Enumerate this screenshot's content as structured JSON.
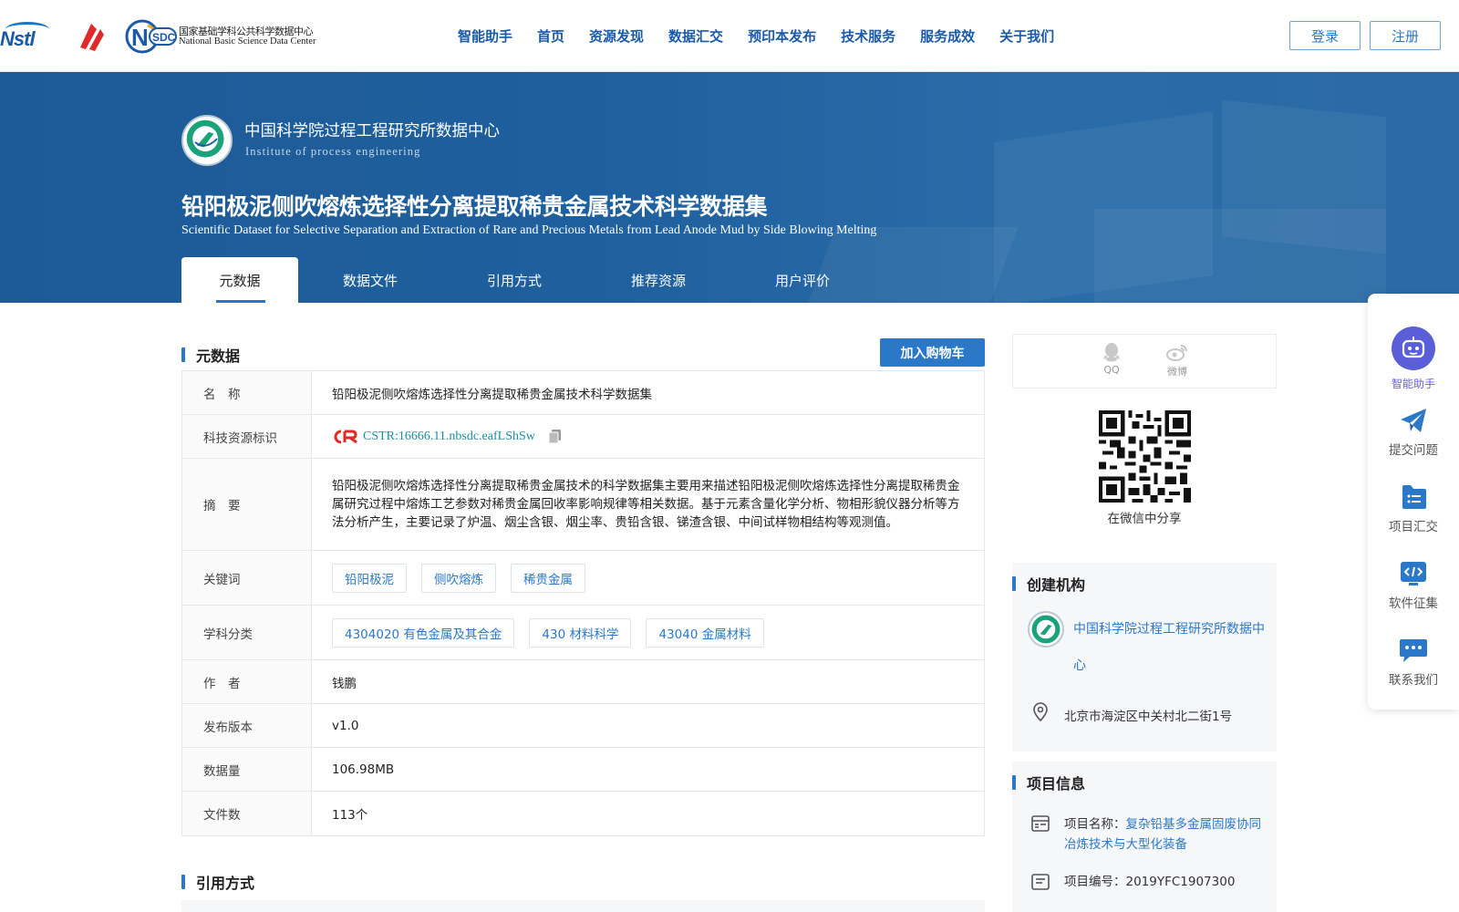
{
  "header": {
    "nav": [
      "智能助手",
      "首页",
      "资源发现",
      "数据汇交",
      "预印本发布",
      "技术服务",
      "服务成效",
      "关于我们"
    ],
    "login": "登录",
    "register": "注册",
    "nsdc_cn": "国家基础学科公共科学数据中心",
    "nsdc_en": "National Basic Science Data Center",
    "nstl_text": "Nstl",
    "nsdc_mark": "SDC"
  },
  "banner": {
    "institution_cn": "中国科学院过程工程研究所数据中心",
    "institution_en": "Institute of process engineering",
    "title": "铅阳极泥侧吹熔炼选择性分离提取稀贵金属技术科学数据集",
    "subtitle": "Scientific Dataset for Selective Separation and Extraction of Rare and Precious Metals from Lead Anode Mud by Side Blowing Melting",
    "tabs": [
      "元数据",
      "数据文件",
      "引用方式",
      "推荐资源",
      "用户评价"
    ]
  },
  "metadata": {
    "section_title": "元数据",
    "cart_button": "加入购物车",
    "rows": {
      "name_key": "名　称",
      "name_val": "铅阳极泥侧吹熔炼选择性分离提取稀贵金属技术科学数据集",
      "id_key": "科技资源标识",
      "id_val": "CSTR:16666.11.nbsdc.eafLShSw",
      "abstract_key": "摘　要",
      "abstract_val": "铅阳极泥侧吹熔炼选择性分离提取稀贵金属技术的科学数据集主要用来描述铅阳极泥侧吹熔炼选择性分离提取稀贵金属研究过程中熔炼工艺参数对稀贵金属回收率影响规律等相关数据。基于元素含量化学分析、物相形貌仪器分析等方法分析产生，主要记录了炉温、烟尘含银、烟尘率、贵铅含银、锑渣含银、中间试样物相结构等观测值。",
      "keywords_key": "关键词",
      "keywords": [
        "铅阳极泥",
        "侧吹熔炼",
        "稀贵金属"
      ],
      "subject_key": "学科分类",
      "subjects": [
        "4304020 有色金属及其合金",
        "430 材料科学",
        "43040 金属材料"
      ],
      "author_key": "作　者",
      "author_val": "钱鹏",
      "version_key": "发布版本",
      "version_val": "v1.0",
      "size_key": "数据量",
      "size_val": "106.98MB",
      "files_key": "文件数",
      "files_val": "113个"
    },
    "citation_title": "引用方式"
  },
  "share": {
    "qq": "QQ",
    "weibo": "微博",
    "wechat": "在微信中分享"
  },
  "org": {
    "title": "创建机构",
    "name": "中国科学院过程工程研究所数据中心",
    "address": "北京市海淀区中关村北二街1号"
  },
  "project": {
    "title": "项目信息",
    "name_label": "项目名称：",
    "name_val": "复杂铅基多金属固废协同冶炼技术与大型化装备",
    "code_label": "项目编号：",
    "code_val": "2019YFC1907300"
  },
  "float_bar": {
    "assistant": "智能助手",
    "submit": "提交问题",
    "project": "项目汇交",
    "software": "软件征集",
    "contact": "联系我们"
  },
  "colors": {
    "brand_blue": "#2b78c8",
    "banner_blue": "#1e5f9d",
    "nav_blue": "#1a5aa8",
    "assistant_purple": "#6a5ce0"
  }
}
